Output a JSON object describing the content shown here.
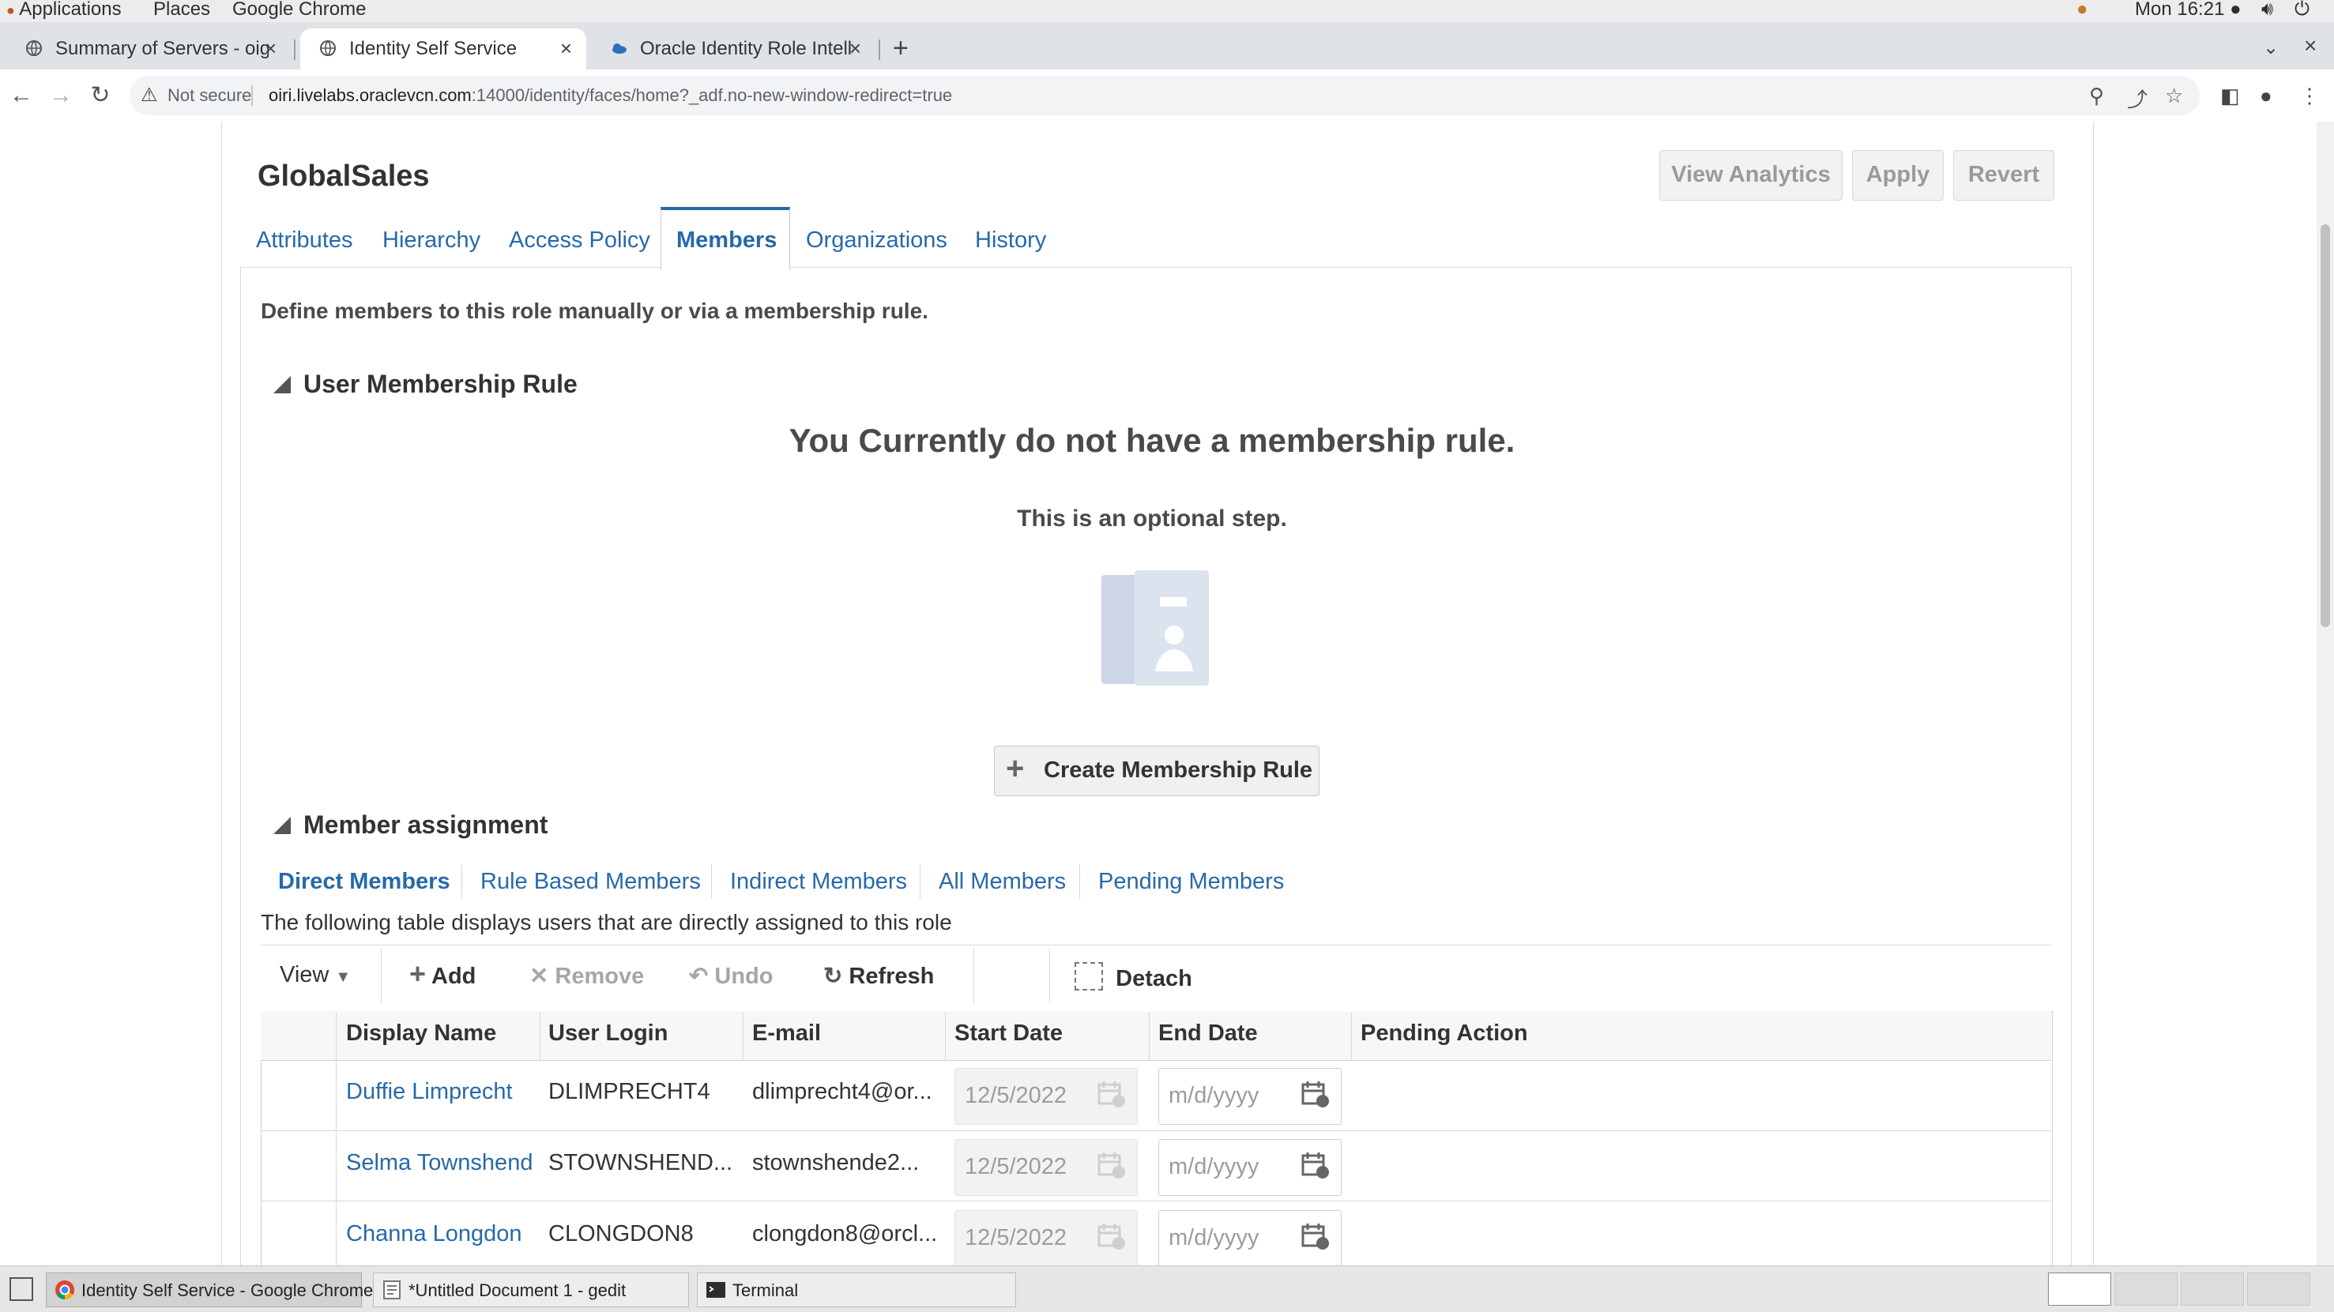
{
  "gnome": {
    "applications": "Applications",
    "places": "Places",
    "browser": "Google Chrome",
    "clock": "Mon 16:21 ●"
  },
  "browser_tabs": [
    {
      "title": "Summary of Servers - oig...",
      "active": false
    },
    {
      "title": "Identity Self Service",
      "active": true
    },
    {
      "title": "Oracle Identity Role Intellig",
      "active": false
    }
  ],
  "address": {
    "security": "Not secure",
    "host": "oiri.livelabs.oraclevcn.com",
    "path": ":14000/identity/faces/home?_adf.no-new-window-redirect=true"
  },
  "role": {
    "name": "GlobalSales",
    "buttons": {
      "analytics": "View Analytics",
      "apply": "Apply",
      "revert": "Revert"
    },
    "tabs": [
      "Attributes",
      "Hierarchy",
      "Access Policy",
      "Members",
      "Organizations",
      "History"
    ],
    "active_tab": "Members"
  },
  "members_tab": {
    "description": "Define members to this role manually or via a membership rule.",
    "rule_section": {
      "title": "User Membership Rule",
      "empty_message": "You Currently do not have a membership rule.",
      "optional_message": "This is an optional step.",
      "create_button": "Create Membership Rule"
    },
    "assignment_section": {
      "title": "Member assignment",
      "subtabs": [
        "Direct Members",
        "Rule Based Members",
        "Indirect Members",
        "All Members",
        "Pending Members"
      ],
      "active_subtab": "Direct Members",
      "table_description": "The following table displays users that are directly assigned to this role",
      "toolbar": {
        "view": "View",
        "add": "Add",
        "remove": "Remove",
        "undo": "Undo",
        "refresh": "Refresh",
        "detach": "Detach"
      },
      "columns": [
        "Display Name",
        "User Login",
        "E-mail",
        "Start Date",
        "End Date",
        "Pending Action"
      ],
      "rows": [
        {
          "display_name": "Duffie Limprecht",
          "login": "DLIMPRECHT4",
          "email": "dlimprecht4@or...",
          "start": "12/5/2022",
          "end_placeholder": "m/d/yyyy"
        },
        {
          "display_name": "Selma Townshend",
          "login": "STOWNSHEND...",
          "email": "stownshende2...",
          "start": "12/5/2022",
          "end_placeholder": "m/d/yyyy"
        },
        {
          "display_name": "Channa Longdon",
          "login": "CLONGDON8",
          "email": "clongdon8@orcl...",
          "start": "12/5/2022",
          "end_placeholder": "m/d/yyyy"
        }
      ]
    }
  },
  "taskbar": [
    {
      "label": "Identity Self Service - Google Chrome",
      "active": true
    },
    {
      "label": "*Untitled Document 1 - gedit",
      "active": false
    },
    {
      "label": "Terminal",
      "active": false
    }
  ],
  "colors": {
    "link": "#2769a8",
    "active_tab_border": "#2769a8"
  }
}
